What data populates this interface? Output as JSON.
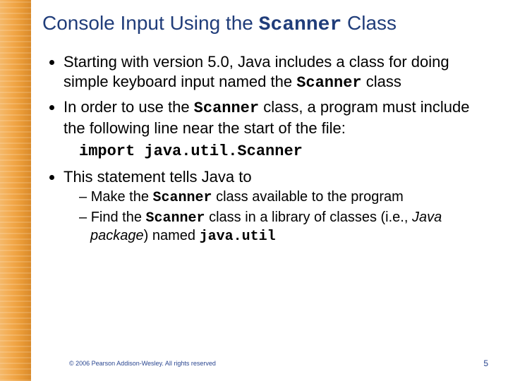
{
  "title": {
    "pre": "Console Input Using the ",
    "code": "Scanner",
    "post": " Class"
  },
  "bullets": {
    "b1": {
      "pre": "Starting with version 5.0, Java includes a class for doing simple keyboard input named the ",
      "code": "Scanner",
      "post": " class"
    },
    "b2": {
      "pre": "In order to use the ",
      "code": "Scanner",
      "post": " class, a program must include the following line near the start of the file:"
    },
    "code_line": "import java.util.Scanner",
    "b3": "This statement tells Java to",
    "sub1": {
      "pre": "Make the ",
      "code": "Scanner",
      "post": " class available to the program"
    },
    "sub2": {
      "pre": "Find the ",
      "code": "Scanner",
      "post1": " class in a library of classes (i.e., ",
      "ital": "Java package",
      "post2": ") named ",
      "code2": "java.util"
    }
  },
  "footer": {
    "copyright": "© 2006 Pearson Addison-Wesley. All rights reserved",
    "page": "5"
  }
}
